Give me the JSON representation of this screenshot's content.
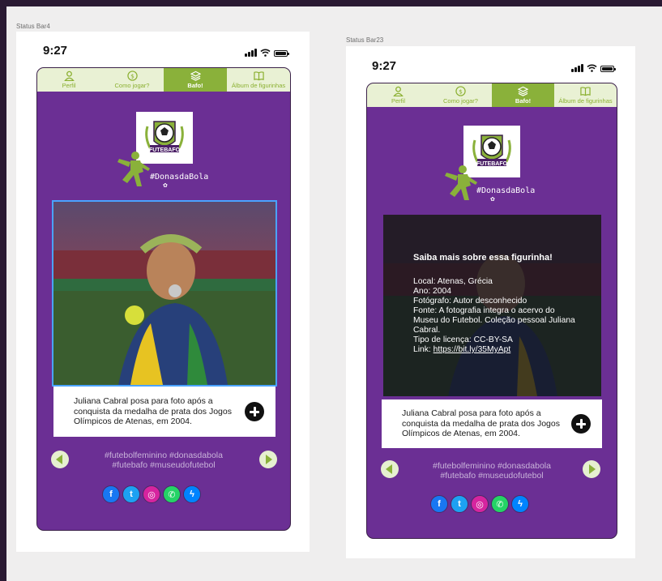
{
  "frames": [
    {
      "artboard_label": "Status Bar4",
      "status": {
        "time": "9:27"
      },
      "tabs": [
        {
          "label": "Perfil",
          "icon": "user-icon",
          "active": false
        },
        {
          "label": "Como jogar?",
          "icon": "dollar-icon",
          "active": false
        },
        {
          "label": "Bafo!",
          "icon": "layers-icon",
          "active": true
        },
        {
          "label": "Álbum de figurinhas",
          "icon": "book-icon",
          "active": false
        }
      ],
      "brand": {
        "logo_text": "FUTEBAFO",
        "hashtag": "#DonasdaBola"
      },
      "caption": "Juliana Cabral posa para foto após a conquista da medalha de prata dos Jogos Olímpicos de Atenas, em 2004.",
      "tags": [
        "#futebolfeminino #donasdabola",
        "#futebafo #museudofutebol"
      ]
    },
    {
      "artboard_label": "Status Bar23",
      "status": {
        "time": "9:27"
      },
      "tabs": [
        {
          "label": "Perfil",
          "icon": "user-icon",
          "active": false
        },
        {
          "label": "Como jogar?",
          "icon": "dollar-icon",
          "active": false
        },
        {
          "label": "Bafo!",
          "icon": "layers-icon",
          "active": true
        },
        {
          "label": "Álbum de figurinhas",
          "icon": "book-icon",
          "active": false
        }
      ],
      "brand": {
        "logo_text": "FUTEBAFO",
        "hashtag": "#DonasdaBola"
      },
      "info": {
        "title": "Saiba mais sobre essa figurinha!",
        "local": "Local: Atenas, Grécia",
        "ano": "Ano: 2004",
        "fotografo": "Fotógrafo: Autor desconhecido",
        "fonte": "Fonte: A fotografia integra o acervo do Museu do Futebol. Coleção pessoal Juliana Cabral.",
        "licenca": "Tipo de licença: CC-BY-SA",
        "link_label": "Link:",
        "link_url": "https://bit.ly/35MyApt"
      },
      "caption": "Juliana Cabral posa para foto após a conquista da medalha de prata dos Jogos Olímpicos de Atenas, em 2004.",
      "tags": [
        "#futebolfeminino #donasdabola",
        "#futebafo #museudofutebol"
      ]
    }
  ],
  "socials": [
    {
      "name": "facebook",
      "glyph": "f",
      "color": "#1877f2"
    },
    {
      "name": "twitter",
      "glyph": "t",
      "color": "#1da1f2"
    },
    {
      "name": "instagram",
      "glyph": "◎",
      "color": "#d6249f"
    },
    {
      "name": "whatsapp",
      "glyph": "✆",
      "color": "#25d366"
    },
    {
      "name": "messenger",
      "glyph": "ϟ",
      "color": "#0084ff"
    }
  ],
  "colors": {
    "purple": "#6b2f94",
    "green": "#8ab13a",
    "tab_bg": "#e9f1d4"
  }
}
